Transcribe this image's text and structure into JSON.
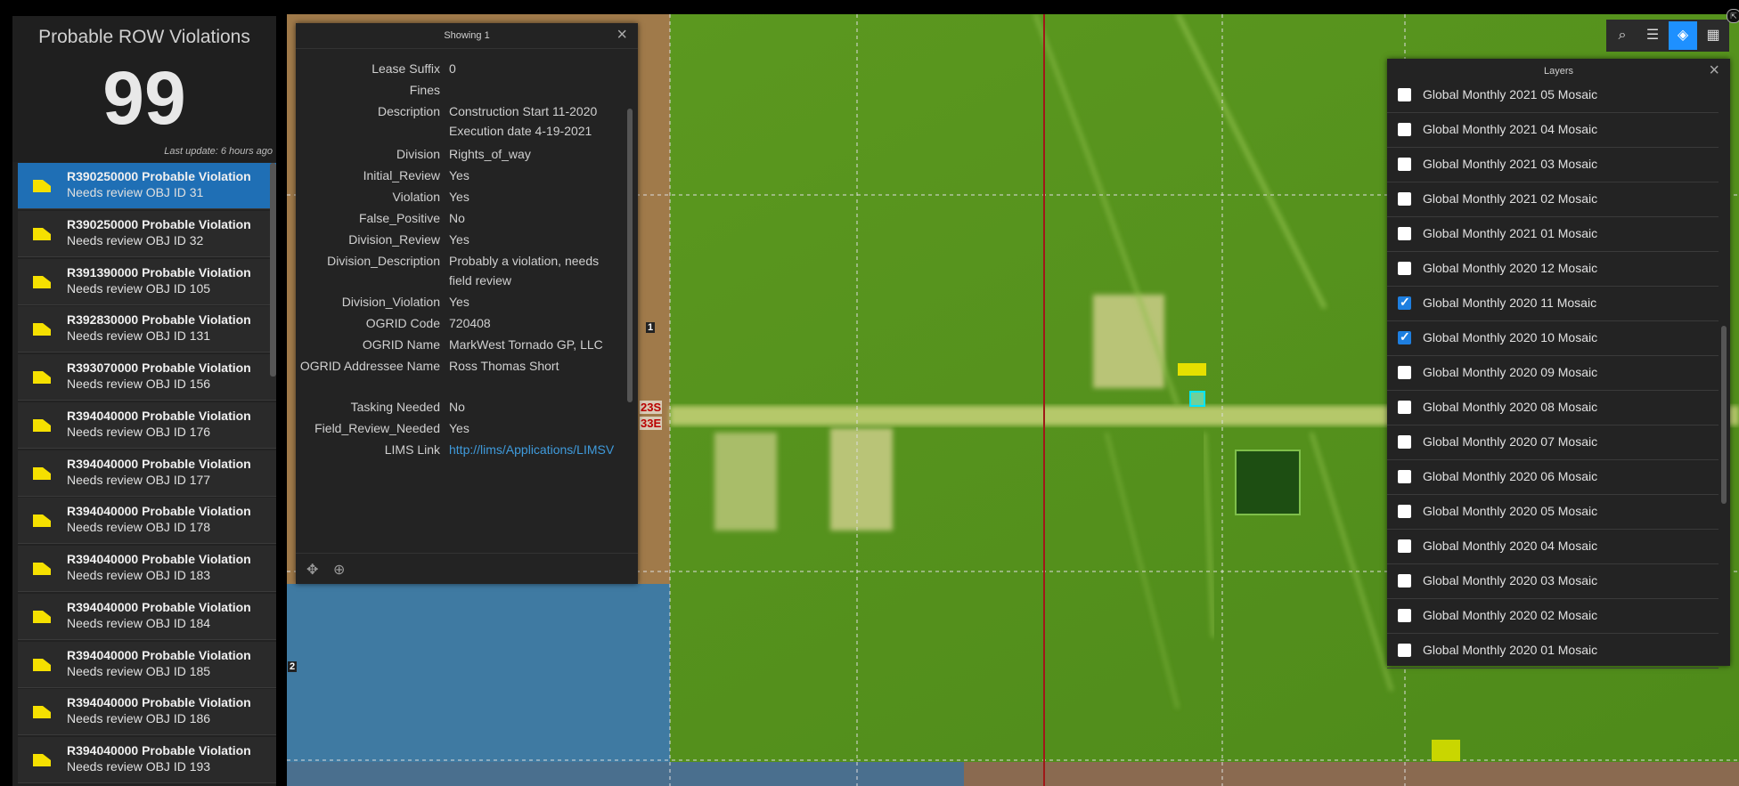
{
  "indicator": {
    "title": "Probable ROW Violations",
    "value": "99",
    "last_update": "Last update: 6 hours ago"
  },
  "list_items": [
    {
      "line1": "R390250000 Probable Violation",
      "line2": "Needs review OBJ ID 31",
      "selected": true
    },
    {
      "line1": "R390250000 Probable Violation",
      "line2": "Needs review OBJ ID 32"
    },
    {
      "line1": "R391390000 Probable Violation",
      "line2": "Needs review OBJ ID 105"
    },
    {
      "line1": "R392830000 Probable Violation",
      "line2": "Needs review OBJ ID 131"
    },
    {
      "line1": "R393070000 Probable Violation",
      "line2": "Needs review OBJ ID 156"
    },
    {
      "line1": "R394040000 Probable Violation",
      "line2": "Needs review OBJ ID 176"
    },
    {
      "line1": "R394040000 Probable Violation",
      "line2": "Needs review OBJ ID 177"
    },
    {
      "line1": "R394040000 Probable Violation",
      "line2": "Needs review OBJ ID 178"
    },
    {
      "line1": "R394040000 Probable Violation",
      "line2": "Needs review OBJ ID 183"
    },
    {
      "line1": "R394040000 Probable Violation",
      "line2": "Needs review OBJ ID 184"
    },
    {
      "line1": "R394040000 Probable Violation",
      "line2": "Needs review OBJ ID 185"
    },
    {
      "line1": "R394040000 Probable Violation",
      "line2": "Needs review OBJ ID 186"
    },
    {
      "line1": "R394040000 Probable Violation",
      "line2": "Needs review OBJ ID 193"
    }
  ],
  "popup": {
    "title": "Showing 1",
    "fields": [
      {
        "k": "Lease Suffix",
        "v": "0"
      },
      {
        "k": "Fines",
        "v": ""
      },
      {
        "k": "Description",
        "v": "Construction Start 11-2020 Execution date 4-19-2021"
      },
      {
        "k": "Division",
        "v": "Rights_of_way"
      },
      {
        "k": "Initial_Review",
        "v": "Yes"
      },
      {
        "k": "Violation",
        "v": "Yes"
      },
      {
        "k": "False_Positive",
        "v": "No"
      },
      {
        "k": "Division_Review",
        "v": "Yes"
      },
      {
        "k": "Division_Description",
        "v": "Probably a violation, needs field review"
      },
      {
        "k": "Division_Violation",
        "v": "Yes"
      },
      {
        "k": "OGRID Code",
        "v": "720408"
      },
      {
        "k": "OGRID Name",
        "v": "MarkWest Tornado GP, LLC"
      },
      {
        "k": "OGRID Addressee Name",
        "v": "Ross Thomas Short"
      },
      {
        "k": "Tasking Needed",
        "v": "No"
      },
      {
        "k": "Field_Review_Needed",
        "v": "Yes"
      },
      {
        "k": "LIMS Link",
        "v": "http://lims/Applications/LIMSV"
      }
    ]
  },
  "map_labels": {
    "township": "23S",
    "range": "33E",
    "section_1": "1",
    "section_2": "2"
  },
  "layers": {
    "title": "Layers",
    "items": [
      {
        "label": "Global Monthly 2021 05 Mosaic",
        "checked": false
      },
      {
        "label": "Global Monthly 2021 04 Mosaic",
        "checked": false
      },
      {
        "label": "Global Monthly 2021 03 Mosaic",
        "checked": false
      },
      {
        "label": "Global Monthly 2021 02 Mosaic",
        "checked": false
      },
      {
        "label": "Global Monthly 2021 01 Mosaic",
        "checked": false
      },
      {
        "label": "Global Monthly 2020 12 Mosaic",
        "checked": false
      },
      {
        "label": "Global Monthly 2020 11 Mosaic",
        "checked": true
      },
      {
        "label": "Global Monthly 2020 10 Mosaic",
        "checked": true
      },
      {
        "label": "Global Monthly 2020 09 Mosaic",
        "checked": false
      },
      {
        "label": "Global Monthly 2020 08 Mosaic",
        "checked": false
      },
      {
        "label": "Global Monthly 2020 07 Mosaic",
        "checked": false
      },
      {
        "label": "Global Monthly 2020 06 Mosaic",
        "checked": false
      },
      {
        "label": "Global Monthly 2020 05 Mosaic",
        "checked": false
      },
      {
        "label": "Global Monthly 2020 04 Mosaic",
        "checked": false
      },
      {
        "label": "Global Monthly 2020 03 Mosaic",
        "checked": false
      },
      {
        "label": "Global Monthly 2020 02 Mosaic",
        "checked": false
      },
      {
        "label": "Global Monthly 2020 01 Mosaic",
        "checked": false
      }
    ]
  },
  "toolbar": {
    "icons": [
      "search-icon",
      "legend-icon",
      "layers-icon",
      "basemap-icon"
    ]
  },
  "colors": {
    "selected": "#1f6fb5",
    "accent": "#1e90ff",
    "marker": "#f5e000",
    "link": "#3f9bdc"
  }
}
